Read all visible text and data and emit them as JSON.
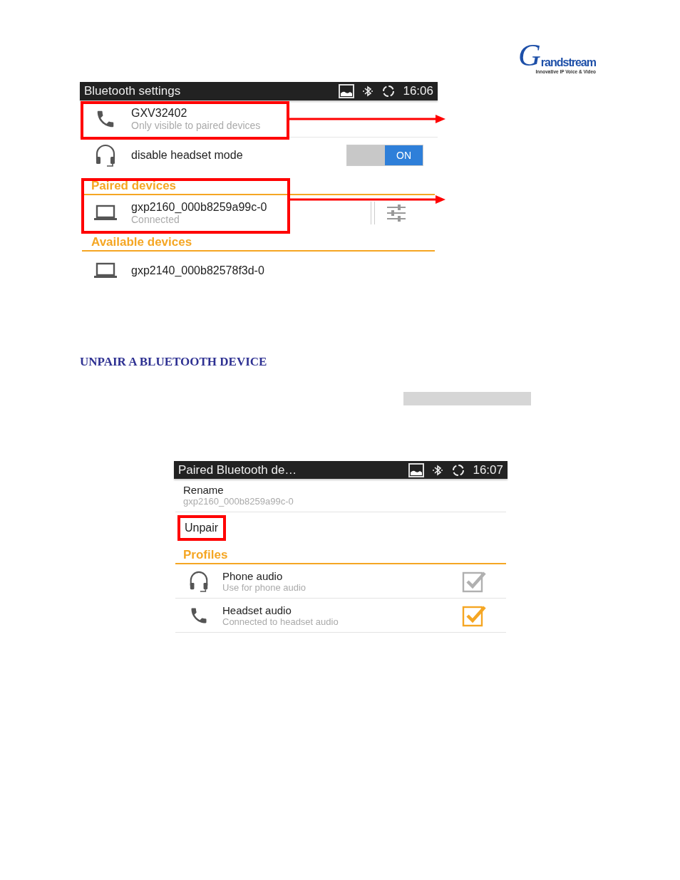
{
  "logo": {
    "name": "Grandstream",
    "tagline": "Innovative IP Voice & Video"
  },
  "screen_1": {
    "status_bar": {
      "title": "Bluetooth settings",
      "time": "16:06"
    },
    "device": {
      "kind": "phone",
      "name": "GXV32402",
      "subtitle": "Only visible to paired devices",
      "highlighted": true
    },
    "headset_mode": {
      "kind": "headset",
      "label": "disable headset mode",
      "toggle": "ON",
      "on": true
    },
    "sections": [
      {
        "title": "Paired devices",
        "highlighted": true,
        "devices": [
          {
            "kind": "laptop",
            "name": "gxp2160_000b8259a99c-0",
            "status": "Connected",
            "settings": true
          }
        ]
      },
      {
        "title": "Available devices",
        "highlighted": false,
        "devices": [
          {
            "kind": "laptop",
            "name": "gxp2140_000b82578f3d-0",
            "settings": false
          }
        ]
      }
    ]
  },
  "heading": "UNPAIR A BLUETOOTH DEVICE",
  "screen_2": {
    "status_bar": {
      "title": "Paired Bluetooth de…",
      "time": "16:07"
    },
    "rename": {
      "label": "Rename",
      "value": "gxp2160_000b8259a99c-0"
    },
    "unpair": {
      "label": "Unpair",
      "highlighted": true
    },
    "profiles": {
      "title": "Profiles",
      "items": [
        {
          "kind": "headset",
          "name": "Phone audio",
          "subtitle": "Use for phone audio",
          "checked": true,
          "disabled": true
        },
        {
          "kind": "phone",
          "name": "Headset audio",
          "subtitle": "Connected to headset audio",
          "checked": true,
          "disabled": false
        }
      ]
    }
  }
}
